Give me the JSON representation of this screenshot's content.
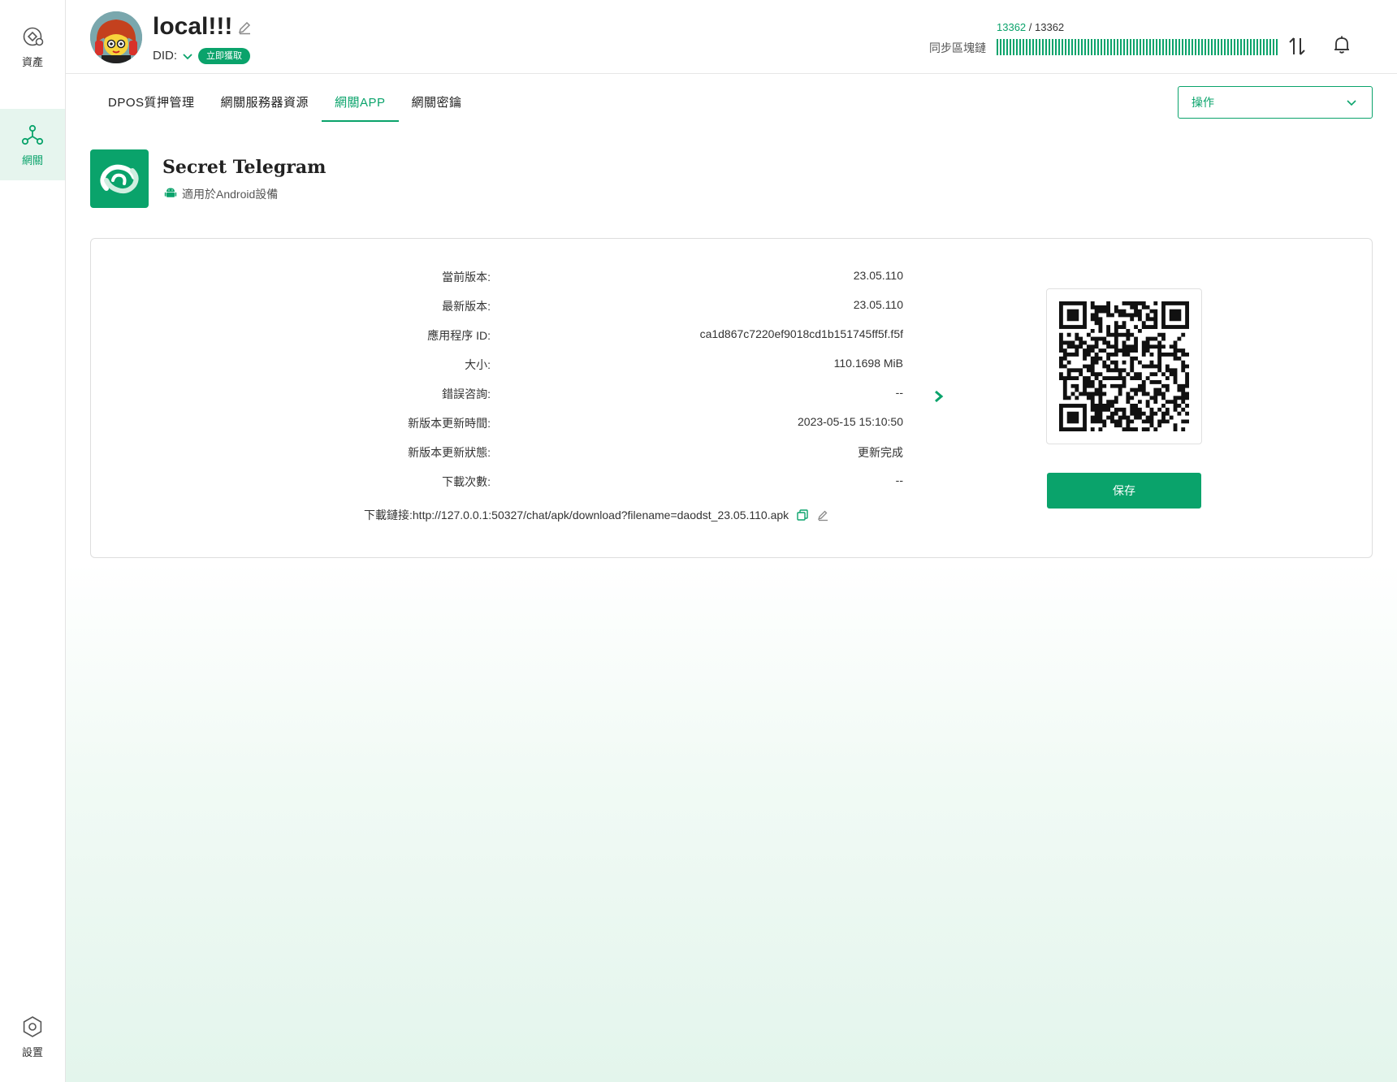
{
  "sidebar": {
    "items": [
      {
        "label": "資產",
        "icon": "asset-icon"
      },
      {
        "label": "網關",
        "icon": "gateway-icon"
      },
      {
        "label": "設置",
        "icon": "settings-icon"
      }
    ]
  },
  "header": {
    "username": "local!!!",
    "did_label": "DID:",
    "claim_badge": "立即獲取",
    "sync": {
      "current": "13362",
      "separator": " / ",
      "total": "13362",
      "label": "同步區塊鏈",
      "progress": 1.0
    }
  },
  "tabs": [
    {
      "label": "DPOS質押管理",
      "active": false
    },
    {
      "label": "網關服務器資源",
      "active": false
    },
    {
      "label": "網關APP",
      "active": true
    },
    {
      "label": "網關密鑰",
      "active": false
    }
  ],
  "operations": {
    "label": "操作"
  },
  "app": {
    "name": "Secret Telegram",
    "platform": "適用於Android設備"
  },
  "details": {
    "rows": [
      {
        "label": "當前版本:",
        "value": "23.05.110"
      },
      {
        "label": "最新版本:",
        "value": "23.05.110"
      },
      {
        "label": "應用程序 ID:",
        "value": "ca1d867c7220ef9018cd1b151745ff5f.f5f"
      },
      {
        "label": "大小:",
        "value": "110.1698 MiB"
      },
      {
        "label": "錯誤咨詢:",
        "value": "--"
      },
      {
        "label": "新版本更新時間:",
        "value": "2023-05-15 15:10:50"
      },
      {
        "label": "新版本更新狀態:",
        "value": "更新完成"
      },
      {
        "label": "下載次數:",
        "value": "--"
      }
    ],
    "download_link_label": "下載鏈接:",
    "download_link": "http://127.0.0.1:50327/chat/apk/download?filename=daodst_23.05.110.apk"
  },
  "qr": {
    "save_label": "保存"
  },
  "colors": {
    "accent": "#0aa36b",
    "accent_light": "#e6f5ee"
  }
}
